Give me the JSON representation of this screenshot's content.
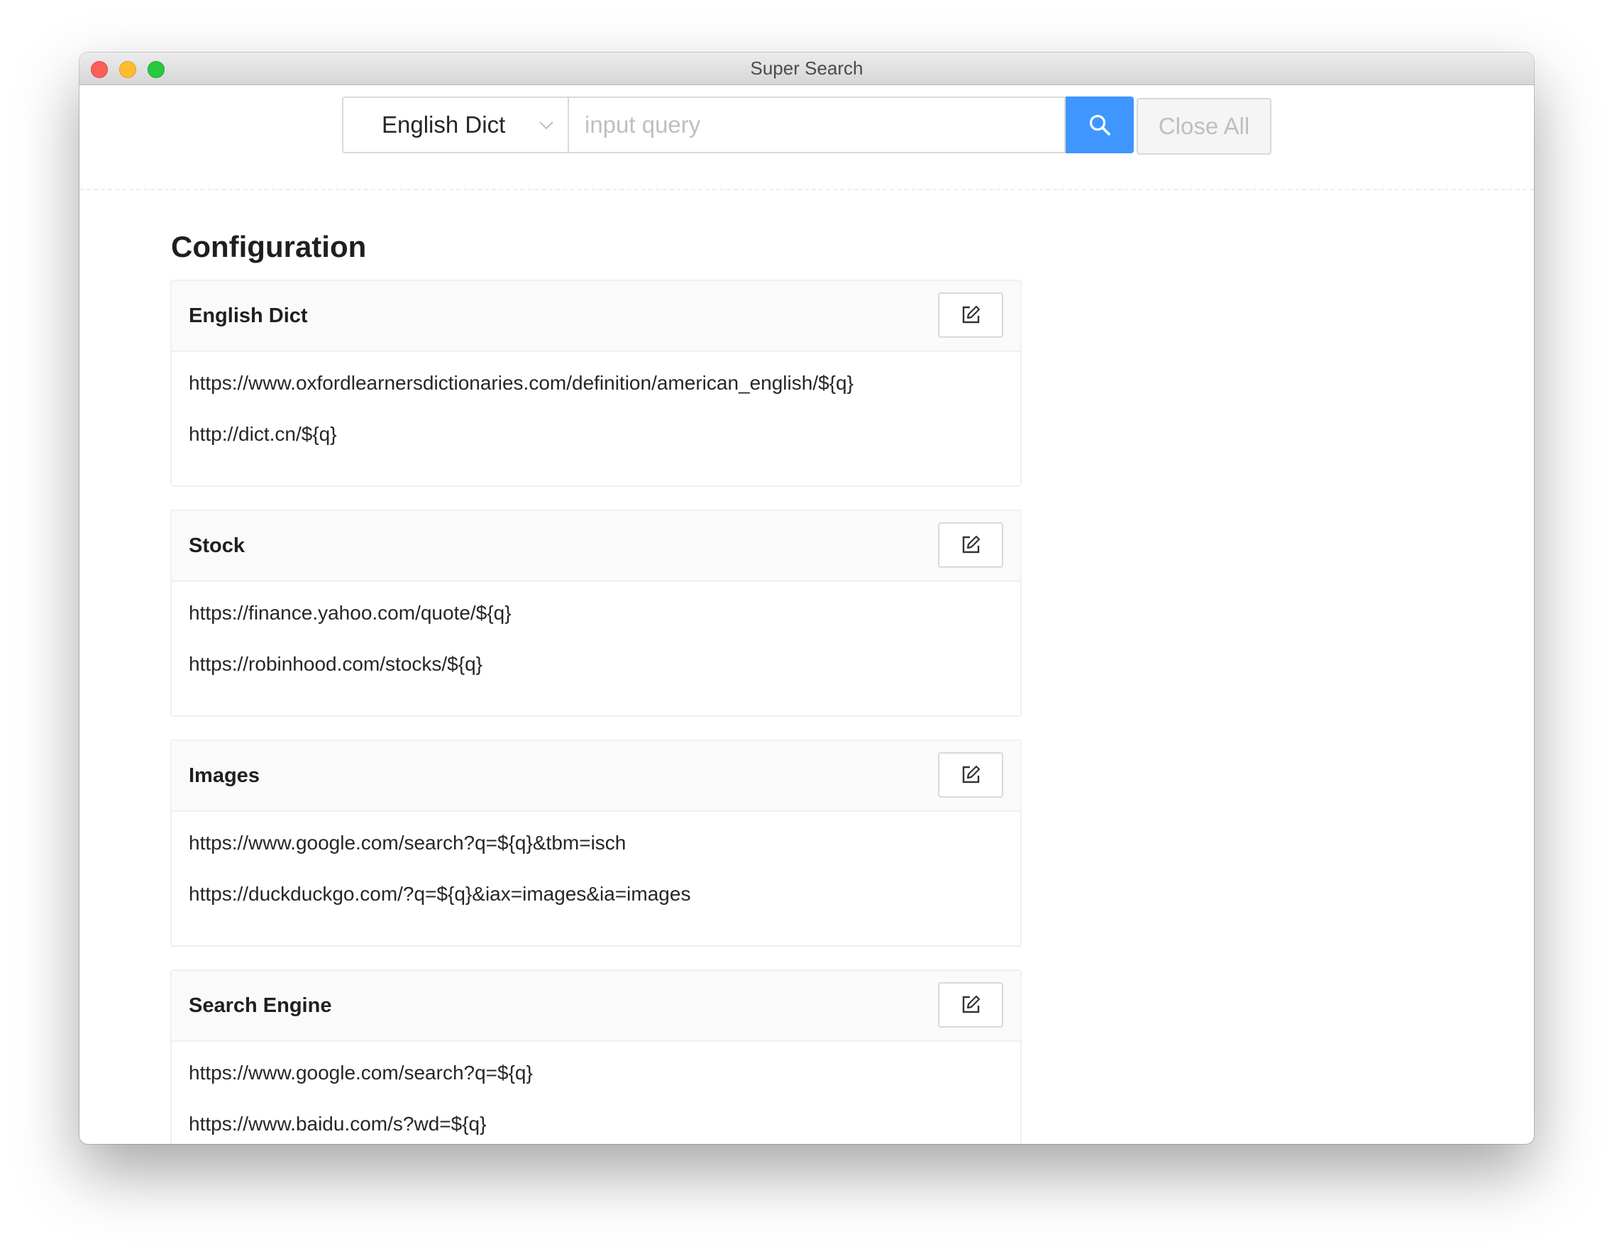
{
  "window": {
    "title": "Super Search"
  },
  "toolbar": {
    "selected_engine": "English Dict",
    "query_placeholder": "input query",
    "query_value": "",
    "close_all_label": "Close All",
    "accent_color": "#4096ff"
  },
  "config": {
    "heading": "Configuration",
    "groups": [
      {
        "name": "English Dict",
        "urls": [
          "https://www.oxfordlearnersdictionaries.com/definition/american_english/${q}",
          "http://dict.cn/${q}"
        ]
      },
      {
        "name": "Stock",
        "urls": [
          "https://finance.yahoo.com/quote/${q}",
          "https://robinhood.com/stocks/${q}"
        ]
      },
      {
        "name": "Images",
        "urls": [
          "https://www.google.com/search?q=${q}&tbm=isch",
          "https://duckduckgo.com/?q=${q}&iax=images&ia=images"
        ]
      },
      {
        "name": "Search Engine",
        "urls": [
          "https://www.google.com/search?q=${q}",
          "https://www.baidu.com/s?wd=${q}"
        ]
      }
    ]
  }
}
